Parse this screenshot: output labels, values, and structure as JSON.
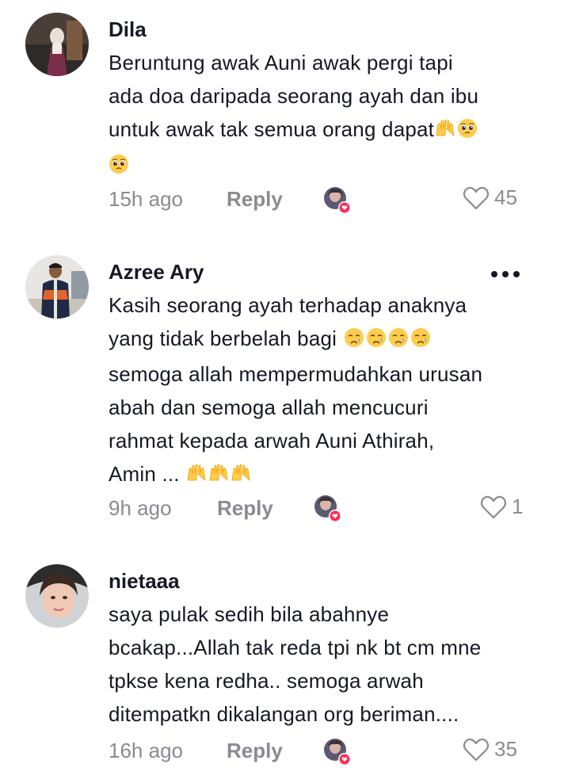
{
  "comments": [
    {
      "username": "Dila",
      "line1": "Beruntung awak Auni awak pergi tapi",
      "line2": "ada doa daripada seorang ayah dan ibu",
      "line3": "untuk awak tak semua orang dapat",
      "time": "15h ago",
      "reply": "Reply",
      "likes": "45"
    },
    {
      "username": "Azree Ary",
      "line1": "Kasih seorang ayah terhadap anaknya",
      "line2": "yang tidak berbelah bagi",
      "line3": "semoga allah mempermudahkan urusan",
      "line4": "abah dan semoga allah mencucuri",
      "line5": "rahmat kepada arwah Auni Athirah,",
      "line6": "Amin ...",
      "time": "9h ago",
      "reply": "Reply",
      "likes": "1"
    },
    {
      "username": "nietaaa",
      "line1": "saya pulak sedih bila abahnye",
      "line2": "bcakap...Allah tak reda tpi nk bt cm mne",
      "line3": "tpkse kena redha.. semoga arwah",
      "line4": "ditempatkn dikalangan org beriman....",
      "time": "16h ago",
      "reply": "Reply",
      "likes": "35"
    }
  ],
  "icons": [
    "heart-icon",
    "more-icon",
    "pleading-face-emoji",
    "raised-hands-emoji",
    "crying-face-emoji",
    "creator-liked-badge"
  ],
  "colors": {
    "text": "#161823",
    "meta": "#8a8b91",
    "badge": "#fe2c55"
  }
}
